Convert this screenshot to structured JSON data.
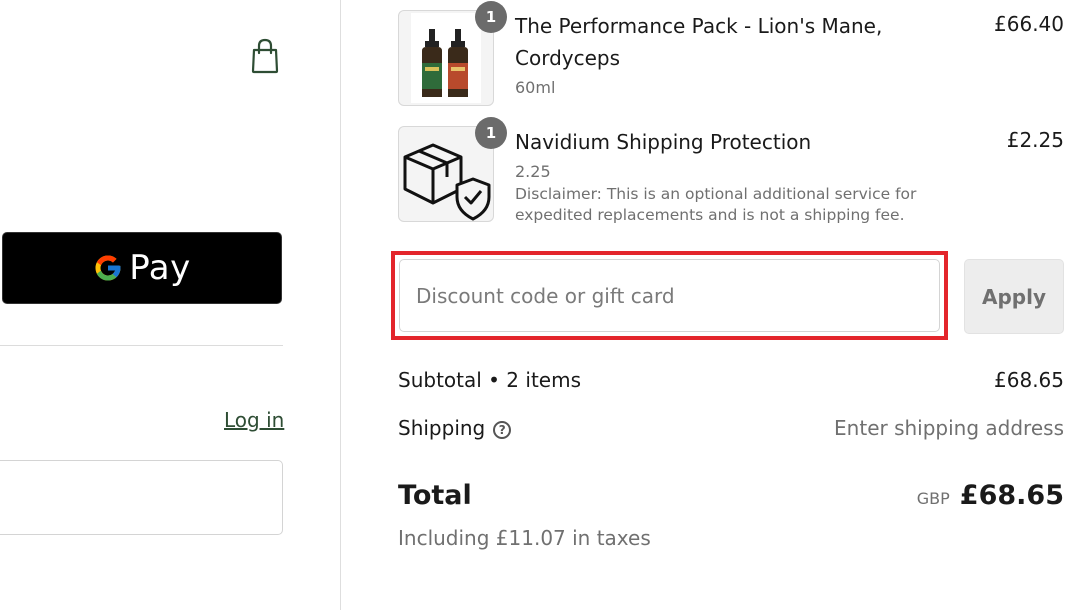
{
  "left": {
    "gpay": {
      "g_letter": "G",
      "label": "Pay"
    },
    "login_link": "Log in",
    "email_field": {
      "placeholder": ""
    }
  },
  "items": [
    {
      "quantity": "1",
      "name": "The Performance Pack - Lion's Mane, Cordyceps",
      "variant": "60ml",
      "price": "£66.40"
    },
    {
      "quantity": "1",
      "name": "Navidium Shipping Protection",
      "variant": "2.25",
      "price": "£2.25",
      "disclaimer": "Disclaimer: This is an optional additional service for expedited replacements and is not a shipping fee."
    }
  ],
  "discount": {
    "placeholder": "Discount code or gift card",
    "apply_label": "Apply"
  },
  "summary": {
    "subtotal_label": "Subtotal • 2 items",
    "subtotal_value": "£68.65",
    "shipping_label": "Shipping",
    "shipping_help": "?",
    "shipping_value": "Enter shipping address",
    "total_label": "Total",
    "currency": "GBP",
    "total_value": "£68.65",
    "taxes_note": "Including £11.07 in taxes"
  },
  "colors": {
    "accent_green": "#2e4d34",
    "highlight_red": "#e3252b",
    "gpay_bg": "#000000"
  }
}
